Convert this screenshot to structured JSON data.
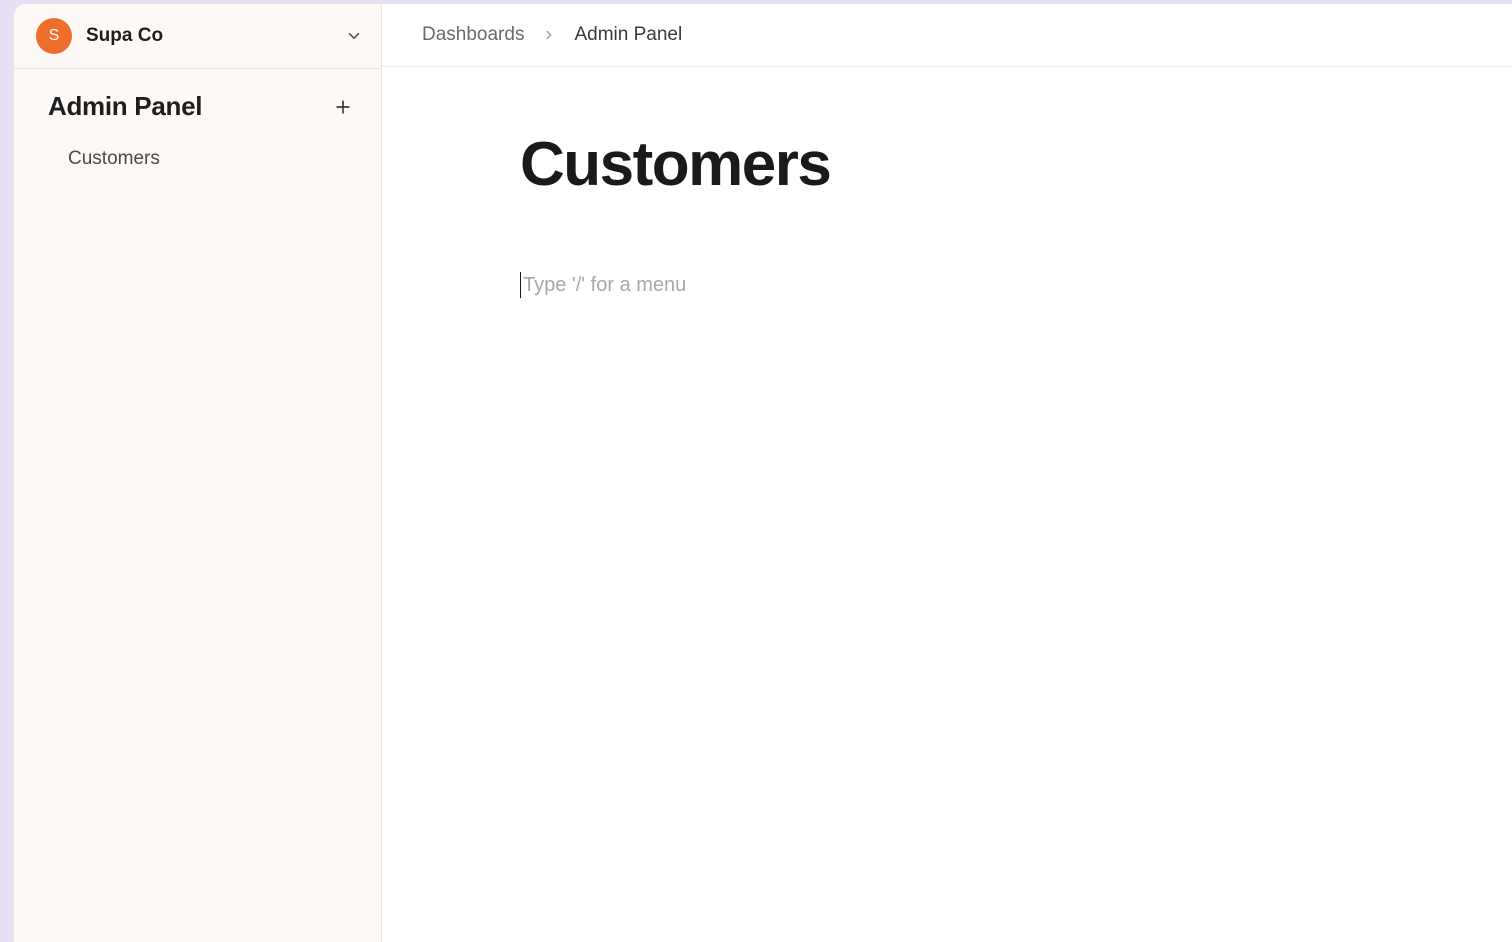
{
  "org": {
    "avatar_initial": "S",
    "name": "Supa Co"
  },
  "sidebar": {
    "section_title": "Admin Panel",
    "items": [
      {
        "label": "Customers"
      }
    ]
  },
  "breadcrumb": {
    "root": "Dashboards",
    "current": "Admin Panel"
  },
  "main": {
    "title": "Customers",
    "editor_placeholder": "Type '/' for a menu"
  }
}
